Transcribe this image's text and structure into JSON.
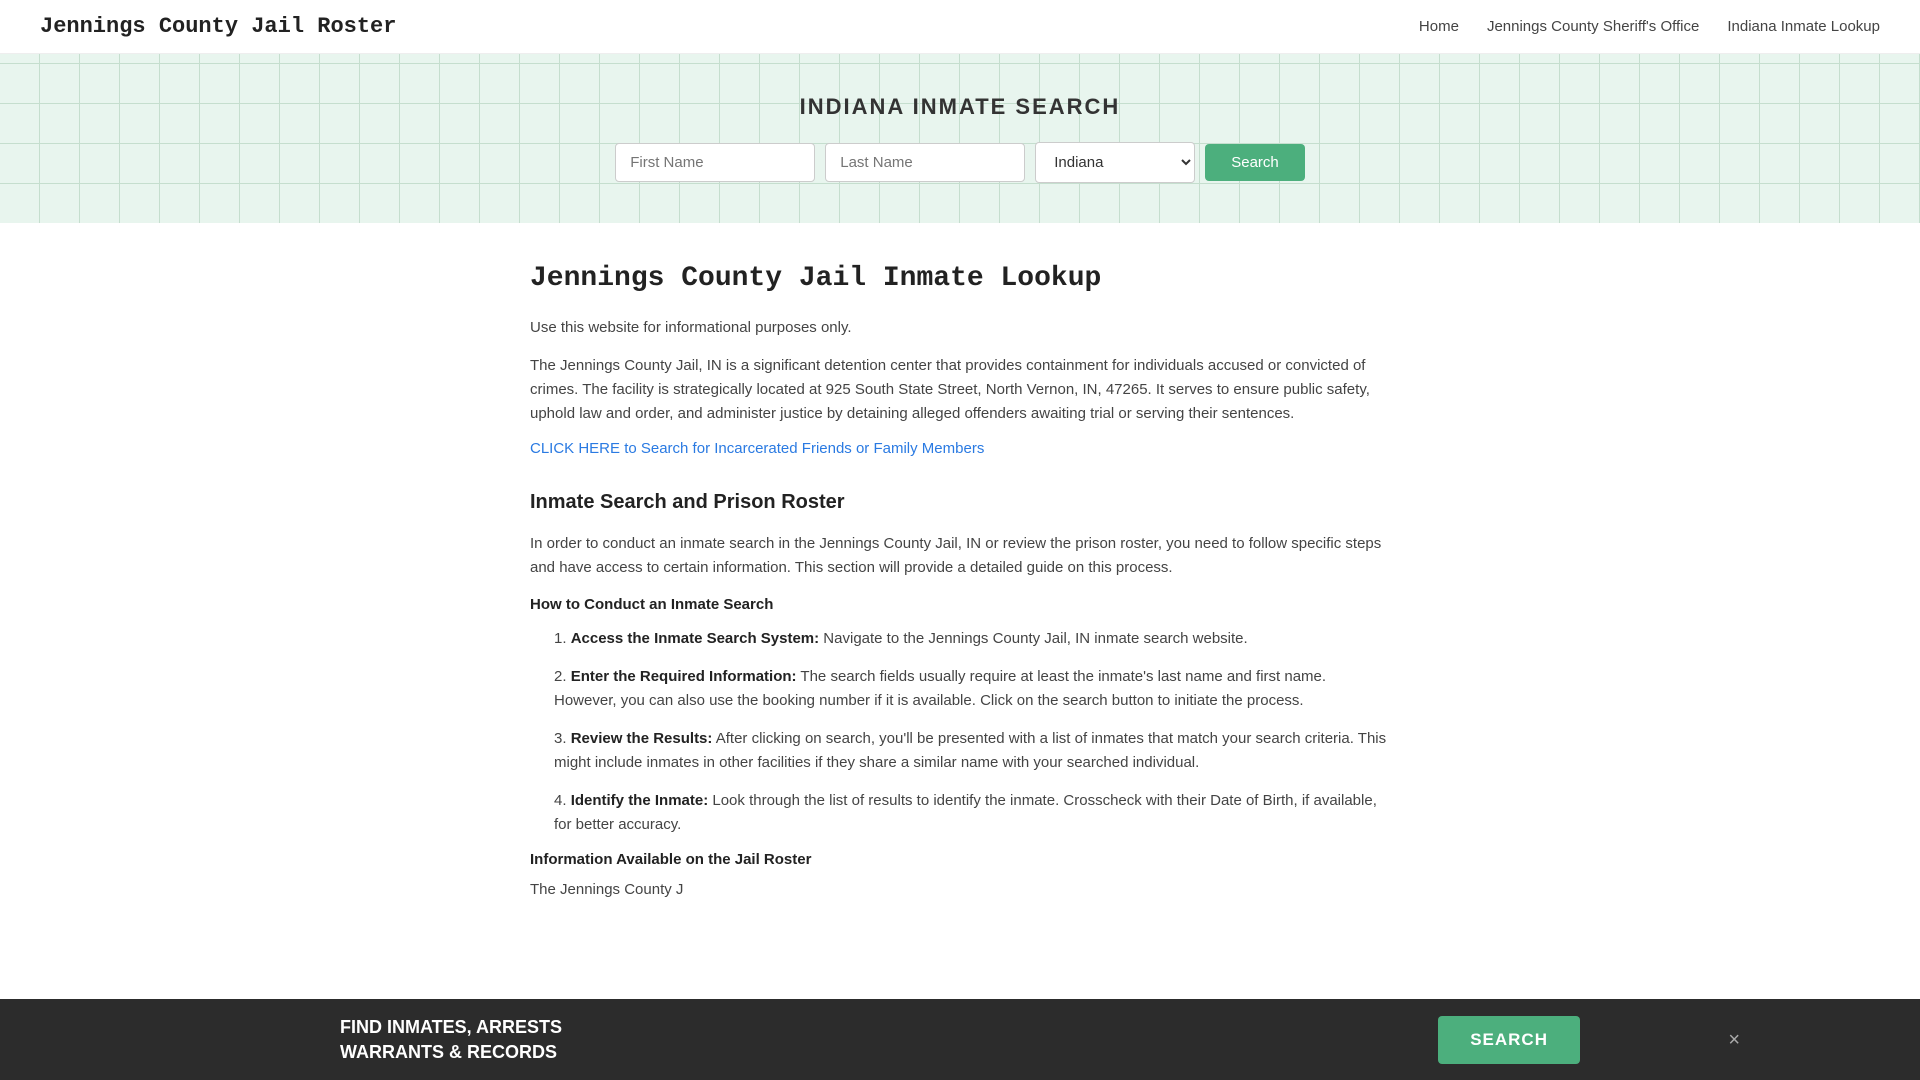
{
  "nav": {
    "title": "Jennings County Jail Roster",
    "links": [
      {
        "label": "Home",
        "href": "#"
      },
      {
        "label": "Jennings County Sheriff's Office",
        "href": "#"
      },
      {
        "label": "Indiana Inmate Lookup",
        "href": "#"
      }
    ]
  },
  "hero": {
    "title": "INDIANA INMATE SEARCH",
    "form": {
      "first_name_placeholder": "First Name",
      "last_name_placeholder": "Last Name",
      "state_default": "Indiana",
      "search_button": "Search"
    }
  },
  "main": {
    "page_heading": "Jennings County Jail Inmate Lookup",
    "intro_note": "Use this website for informational purposes only.",
    "intro_paragraph": "The Jennings County Jail, IN is a significant detention center that provides containment for individuals accused or convicted of crimes. The facility is strategically located at 925 South State Street, North Vernon, IN, 47265. It serves to ensure public safety, uphold law and order, and administer justice by detaining alleged offenders awaiting trial or serving their sentences.",
    "click_link_text": "CLICK HERE to Search for Incarcerated Friends or Family Members",
    "section1_heading": "Inmate Search and Prison Roster",
    "section1_paragraph": "In order to conduct an inmate search in the Jennings County Jail, IN or review the prison roster, you need to follow specific steps and have access to certain information. This section will provide a detailed guide on this process.",
    "steps_heading": "How to Conduct an Inmate Search",
    "steps": [
      {
        "num": "1",
        "bold": "Access the Inmate Search System:",
        "text": " Navigate to the Jennings County Jail, IN inmate search website."
      },
      {
        "num": "2",
        "bold": "Enter the Required Information:",
        "text": " The search fields usually require at least the inmate's last name and first name. However, you can also use the booking number if it is available. Click on the search button to initiate the process."
      },
      {
        "num": "3",
        "bold": "Review the Results:",
        "text": " After clicking on search, you'll be presented with a list of inmates that match your search criteria. This might include inmates in other facilities if they share a similar name with your searched individual."
      },
      {
        "num": "4",
        "bold": "Identify the Inmate:",
        "text": " Look through the list of results to identify the inmate. Crosscheck with their Date of Birth, if available, for better accuracy."
      }
    ],
    "info_heading": "Information Available on the Jail Roster",
    "info_paragraph": "The Jennings County J"
  },
  "bottom_banner": {
    "line1": "FIND INMATES, ARRESTS",
    "line2": "WARRANTS & RECORDS",
    "button_label": "SEARCH",
    "close_label": "×"
  }
}
